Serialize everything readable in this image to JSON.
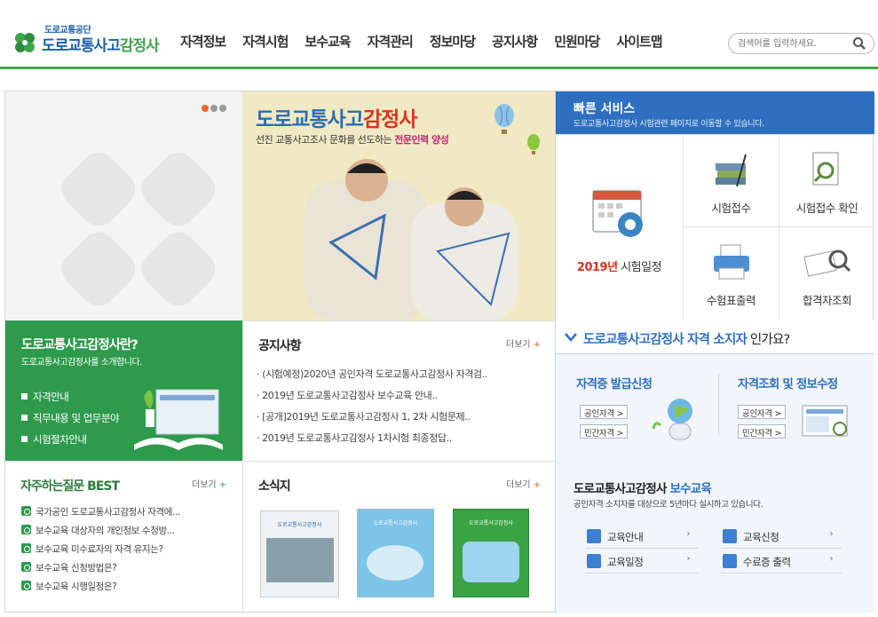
{
  "header": {
    "logo_small": "도로교통공단",
    "logo_big_a": "도로교통사고",
    "logo_big_b": "감정사",
    "nav": [
      "자격정보",
      "자격시험",
      "보수교육",
      "자격관리",
      "정보마당",
      "공지사항",
      "민원마당",
      "사이트맵"
    ],
    "search_placeholder": "검색어를 입력하세요."
  },
  "banner": {
    "title_a": "도로교통사고",
    "title_b": "감정사",
    "subtitle_a": "선진 교통사고조사 문화를 선도하는 ",
    "subtitle_b": "전문인력 양성"
  },
  "quick": {
    "title": "빠른 서비스",
    "subtitle": "도로교통사고감정사 시험관련 페이지로 이동할 수 있습니다.",
    "schedule_year": "2019년",
    "schedule_label": "시험일정",
    "items": [
      "시험접수",
      "시험접수 확인",
      "수험표출력",
      "합격자조회"
    ]
  },
  "intro": {
    "title": "도로교통사고감정사란?",
    "subtitle": "도로교통사고감정사를 소개합니다.",
    "links": [
      "자격안내",
      "직무내용 및 업무분야",
      "시험절차안내"
    ]
  },
  "notice": {
    "title": "공지사항",
    "more": "더보기",
    "items": [
      "· (시험예정)2020년 공인자격 도로교통사고감정사 자격검..",
      "· 2019년 도로교통사고감정사 보수교육 안내..",
      "· [공개]2019년 도로교통사고감정사 1, 2차 시험문제..",
      "· 2019년 도로교통사고감정사 1차시험 최종정답.."
    ]
  },
  "faq": {
    "title": "자주하는질문 BEST",
    "more": "더보기",
    "items": [
      "국가공인 도로교통사고감정사 자격에...",
      "보수교육 대상자의 개인정보 수정방...",
      "보수교육 미수료자의 자격 유지는?",
      "보수교육 신청방법은?",
      "보수교육 시행일정은?"
    ]
  },
  "news": {
    "title": "소식지",
    "more": "더보기",
    "covers": [
      "도로교통사고감정사",
      "도로교통사고감정사",
      "도로교통사고감정사"
    ]
  },
  "cert": {
    "question_a": "도로교통사고감정사 자격 소지자",
    "question_b": " 인가요?",
    "issue_title": "자격증 발급신청",
    "lookup_title": "자격조회 및 정보수정",
    "public_btn": "공인자격 >",
    "private_btn": "민간자격 >",
    "edu_title_a": "도로교통사고감정사 ",
    "edu_title_b": "보수교육",
    "edu_subtitle": "공인자격 소지자를 대상으로 5년마다 실시하고 있습니다.",
    "edu_links": [
      "교육안내",
      "교육신청",
      "교육일정",
      "수료증 출력"
    ]
  },
  "colors": {
    "green": "#2e9a4c",
    "blue": "#2e6fc0",
    "accent_red": "#d9331f"
  }
}
